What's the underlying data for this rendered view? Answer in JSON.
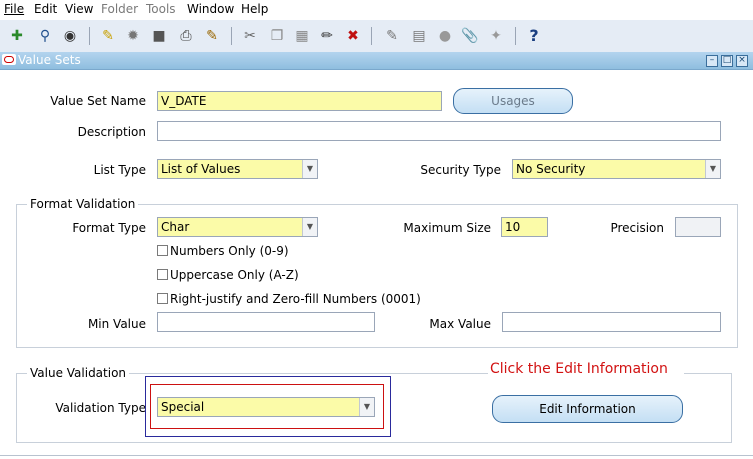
{
  "menubar": {
    "items": [
      {
        "label": "File",
        "enabled": true
      },
      {
        "label": "Edit",
        "enabled": true
      },
      {
        "label": "View",
        "enabled": true
      },
      {
        "label": "Folder",
        "enabled": false
      },
      {
        "label": "Tools",
        "enabled": false
      },
      {
        "label": "Window",
        "enabled": true
      },
      {
        "label": "Help",
        "enabled": true
      }
    ]
  },
  "toolbar": {
    "icons": [
      "new-record-icon",
      "find-icon",
      "navigator-icon",
      "save-icon",
      "switch-responsibility-icon",
      "print-icon",
      "close-form-icon",
      "cut-icon",
      "copy-icon",
      "paste-icon",
      "clear-record-icon",
      "delete-record-icon",
      "edit-field-icon",
      "zoom-icon",
      "translations-icon",
      "attachments-icon",
      "folder-tools-icon",
      "help-icon"
    ],
    "help_glyph": "?"
  },
  "window": {
    "title": "Value Sets"
  },
  "form": {
    "value_set_name_label": "Value Set Name",
    "value_set_name": "V_DATE",
    "usages_button": "Usages",
    "description_label": "Description",
    "description": "",
    "list_type_label": "List Type",
    "list_type": "List of Values",
    "security_type_label": "Security Type",
    "security_type": "No Security",
    "format_validation_title": "Format Validation",
    "format_type_label": "Format Type",
    "format_type": "Char",
    "maximum_size_label": "Maximum Size",
    "maximum_size": "10",
    "precision_label": "Precision",
    "precision": "",
    "numbers_only_label": "Numbers Only (0-9)",
    "numbers_only_checked": false,
    "uppercase_only_label": "Uppercase Only (A-Z)",
    "uppercase_only_checked": false,
    "right_justify_label": "Right-justify and Zero-fill Numbers (0001)",
    "right_justify_checked": false,
    "min_value_label": "Min Value",
    "min_value": "",
    "max_value_label": "Max Value",
    "max_value": "",
    "value_validation_title": "Value Validation",
    "validation_type_label": "Validation Type",
    "validation_type": "Special",
    "edit_information_button": "Edit Information",
    "callout_text": "Click the Edit Information"
  },
  "colors": {
    "required_field": "#fbfba8",
    "title_bar": "#8fbedf",
    "callout": "#d21212",
    "highlight_blue": "#2a2a9c",
    "highlight_red": "#cc1111"
  }
}
